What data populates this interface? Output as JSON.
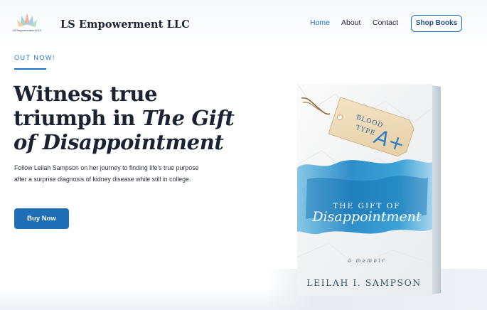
{
  "header": {
    "logo_text": "LS Empowerment LLC",
    "brand": "LS Empowerment LLC",
    "nav": [
      {
        "label": "Home",
        "active": true
      },
      {
        "label": "About",
        "active": false
      },
      {
        "label": "Contact",
        "active": false
      }
    ],
    "cta": "Shop Books"
  },
  "hero": {
    "eyebrow": "OUT NOW!",
    "headline_plain": "Witness true triumph in",
    "headline_italic": "The Gift of Disappointment",
    "description": "Follow Leilah Sampson on her journey to finding life's true purpose after a surprise diagnosis of kidney disease while still in college.",
    "button": "Buy Now"
  },
  "book": {
    "tag_line1": "BLOOD",
    "tag_line2": "TYPE",
    "tag_grade": "A+",
    "title_top": "THE GIFT OF",
    "title_script": "Disappointment",
    "subtitle": "a memoir",
    "author": "LEILAH I. SAMPSON"
  },
  "colors": {
    "accent": "#1a73c7",
    "button": "#1e6fb8",
    "heading": "#1b2232",
    "watercolor": "#1e88c8"
  }
}
